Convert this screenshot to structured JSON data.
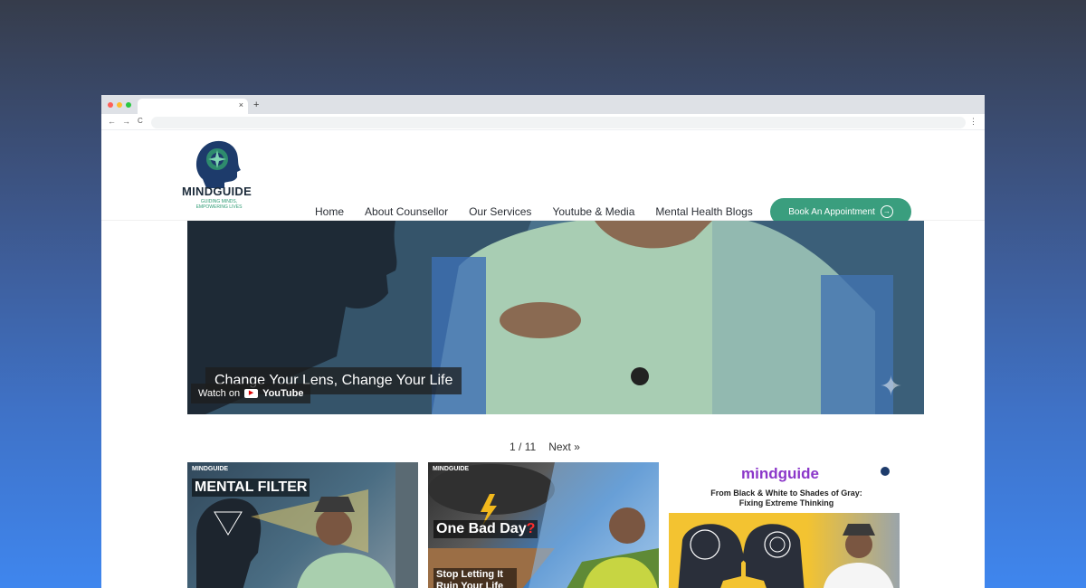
{
  "browser": {
    "window_dots": [
      "#ff5f57",
      "#febc2e",
      "#28c840"
    ],
    "tab_close": "×",
    "new_tab": "+",
    "back": "←",
    "forward": "→",
    "reload": "C",
    "menu": "⋮"
  },
  "header": {
    "logo_text": "MINDGUIDE",
    "logo_tagline": "GUIDING MINDS, EMPOWERING LIVES",
    "nav": [
      "Home",
      "About Counsellor",
      "Our Services",
      "Youtube & Media",
      "Mental Health Blogs"
    ],
    "cta_label": "Book An Appointment",
    "cta_icon": "arrow-circle-icon",
    "accent_color": "#3a9e7e"
  },
  "video": {
    "caption": "Change Your Lens, Change Your Life",
    "watch_on": "Watch on",
    "platform": "YouTube"
  },
  "pagination": {
    "current": "1",
    "total": "11",
    "separator": "/",
    "next_label": "Next »"
  },
  "cards": [
    {
      "brand": "MINDGUIDE",
      "title": "MENTAL FILTER"
    },
    {
      "brand": "MINDGUIDE",
      "title": "One Bad Day",
      "title_mark": "?",
      "subtitle": "Stop Letting It Ruin Your Life"
    },
    {
      "brand": "mindguide",
      "subtitle": "From Black & White to Shades of Gray: Fixing Extreme Thinking"
    }
  ]
}
